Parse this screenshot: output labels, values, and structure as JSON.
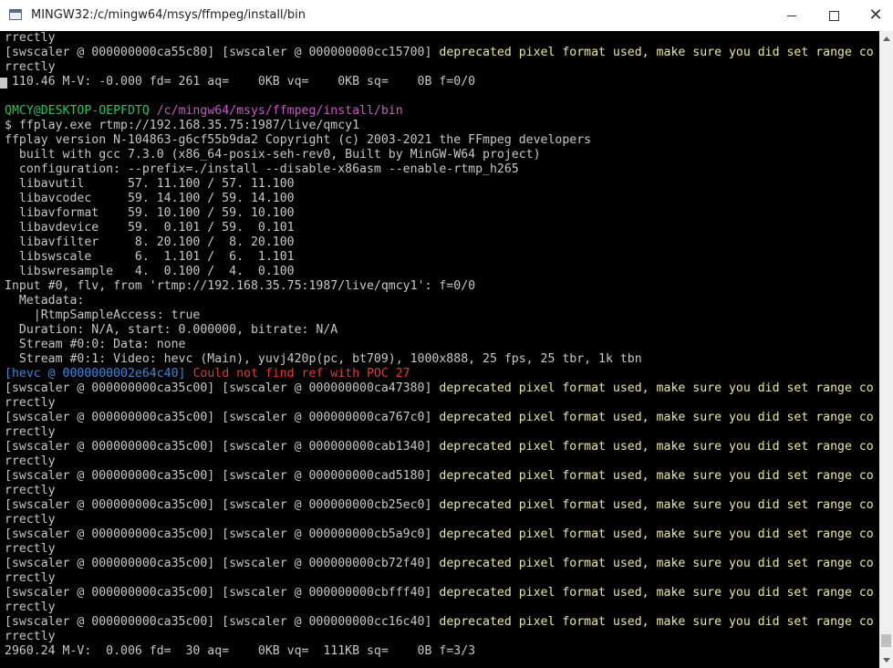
{
  "window": {
    "title": "MINGW32:/c/mingw64/msys/ffmpeg/install/bin"
  },
  "colors": {
    "background": "#000000",
    "default_text": "#c8c8c8",
    "warning_text": "#e8e8a0",
    "prompt_user": "#2ec05a",
    "prompt_path": "#c85ac8",
    "hevc_tag": "#3a8adc",
    "error_text": "#e03a3a"
  },
  "terminal": {
    "lines": [
      [
        [
          "w",
          "rrectly"
        ]
      ],
      [
        [
          "w",
          "[swscaler @ 000000000ca55c80] [swscaler @ 000000000cc15700] "
        ],
        [
          "y",
          "deprecated pixel format used, make sure you did set range co"
        ]
      ],
      [
        [
          "w",
          "rrectly"
        ]
      ],
      [
        [
          "w",
          " 110.46 M-V: -0.000 fd= 261 aq=    0KB vq=    0KB sq=    0B f=0/0"
        ]
      ],
      [
        [
          "w",
          ""
        ]
      ],
      [
        [
          "g",
          "QMCY@DESKTOP-OEPFDTQ "
        ],
        [
          "m",
          "/c/mingw64/msys/ffmpeg/install/bin"
        ]
      ],
      [
        [
          "w",
          "$ ffplay.exe rtmp://192.168.35.75:1987/live/qmcy1"
        ]
      ],
      [
        [
          "w",
          "ffplay version N-104863-g6cf55b9da2 Copyright (c) 2003-2021 the FFmpeg developers"
        ]
      ],
      [
        [
          "w",
          "  built with gcc 7.3.0 (x86_64-posix-seh-rev0, Built by MinGW-W64 project)"
        ]
      ],
      [
        [
          "w",
          "  configuration: --prefix=./install --disable-x86asm --enable-rtmp_h265"
        ]
      ],
      [
        [
          "w",
          "  libavutil      57. 11.100 / 57. 11.100"
        ]
      ],
      [
        [
          "w",
          "  libavcodec     59. 14.100 / 59. 14.100"
        ]
      ],
      [
        [
          "w",
          "  libavformat    59. 10.100 / 59. 10.100"
        ]
      ],
      [
        [
          "w",
          "  libavdevice    59.  0.101 / 59.  0.101"
        ]
      ],
      [
        [
          "w",
          "  libavfilter     8. 20.100 /  8. 20.100"
        ]
      ],
      [
        [
          "w",
          "  libswscale      6.  1.101 /  6.  1.101"
        ]
      ],
      [
        [
          "w",
          "  libswresample   4.  0.100 /  4.  0.100"
        ]
      ],
      [
        [
          "w",
          "Input #0, flv, from 'rtmp://192.168.35.75:1987/live/qmcy1': f=0/0"
        ]
      ],
      [
        [
          "w",
          "  Metadata:"
        ]
      ],
      [
        [
          "w",
          "    |RtmpSampleAccess: true"
        ]
      ],
      [
        [
          "w",
          "  Duration: N/A, start: 0.000000, bitrate: N/A"
        ]
      ],
      [
        [
          "w",
          "  Stream #0:0: Data: none"
        ]
      ],
      [
        [
          "w",
          "  Stream #0:1: Video: hevc (Main), yuvj420p(pc, bt709), 1000x888, 25 fps, 25 tbr, 1k tbn"
        ]
      ],
      [
        [
          "b",
          "[hevc @ 0000000002e64c40] "
        ],
        [
          "r",
          "Could not find ref with POC 27"
        ]
      ],
      [
        [
          "w",
          "[swscaler @ 000000000ca35c00] [swscaler @ 000000000ca47380] "
        ],
        [
          "y",
          "deprecated pixel format used, make sure you did set range co"
        ]
      ],
      [
        [
          "w",
          "rrectly"
        ]
      ],
      [
        [
          "w",
          "[swscaler @ 000000000ca35c00] [swscaler @ 000000000ca767c0] "
        ],
        [
          "y",
          "deprecated pixel format used, make sure you did set range co"
        ]
      ],
      [
        [
          "w",
          "rrectly"
        ]
      ],
      [
        [
          "w",
          "[swscaler @ 000000000ca35c00] [swscaler @ 000000000cab1340] "
        ],
        [
          "y",
          "deprecated pixel format used, make sure you did set range co"
        ]
      ],
      [
        [
          "w",
          "rrectly"
        ]
      ],
      [
        [
          "w",
          "[swscaler @ 000000000ca35c00] [swscaler @ 000000000cad5180] "
        ],
        [
          "y",
          "deprecated pixel format used, make sure you did set range co"
        ]
      ],
      [
        [
          "w",
          "rrectly"
        ]
      ],
      [
        [
          "w",
          "[swscaler @ 000000000ca35c00] [swscaler @ 000000000cb25ec0] "
        ],
        [
          "y",
          "deprecated pixel format used, make sure you did set range co"
        ]
      ],
      [
        [
          "w",
          "rrectly"
        ]
      ],
      [
        [
          "w",
          "[swscaler @ 000000000ca35c00] [swscaler @ 000000000cb5a9c0] "
        ],
        [
          "y",
          "deprecated pixel format used, make sure you did set range co"
        ]
      ],
      [
        [
          "w",
          "rrectly"
        ]
      ],
      [
        [
          "w",
          "[swscaler @ 000000000ca35c00] [swscaler @ 000000000cb72f40] "
        ],
        [
          "y",
          "deprecated pixel format used, make sure you did set range co"
        ]
      ],
      [
        [
          "w",
          "rrectly"
        ]
      ],
      [
        [
          "w",
          "[swscaler @ 000000000ca35c00] [swscaler @ 000000000cbfff40] "
        ],
        [
          "y",
          "deprecated pixel format used, make sure you did set range co"
        ]
      ],
      [
        [
          "w",
          "rrectly"
        ]
      ],
      [
        [
          "w",
          "[swscaler @ 000000000ca35c00] [swscaler @ 000000000cc16c40] "
        ],
        [
          "y",
          "deprecated pixel format used, make sure you did set range co"
        ]
      ],
      [
        [
          "w",
          "rrectly"
        ]
      ],
      [
        [
          "w",
          "2960.24 M-V:  0.006 fd=  30 aq=    0KB vq=  111KB sq=    0B f=3/3"
        ]
      ]
    ]
  }
}
